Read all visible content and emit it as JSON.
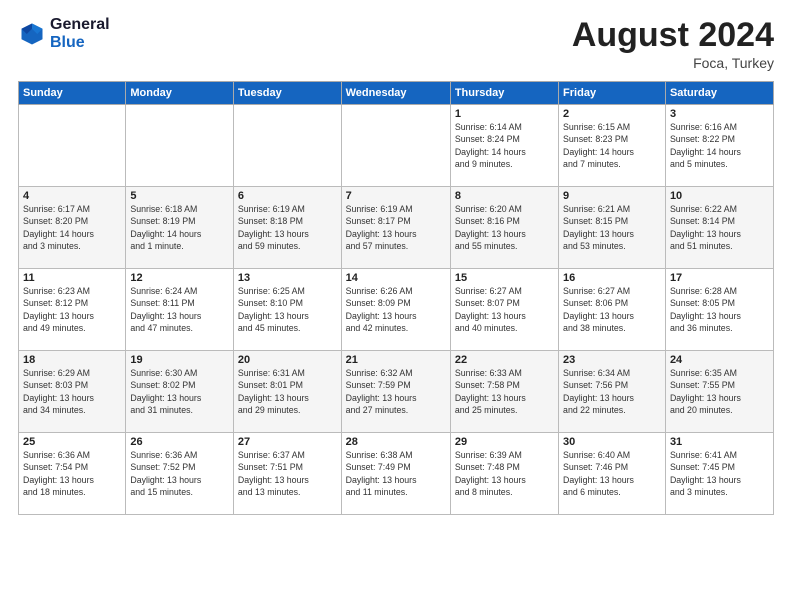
{
  "logo": {
    "line1": "General",
    "line2": "Blue"
  },
  "title": "August 2024",
  "location": "Foca, Turkey",
  "days_header": [
    "Sunday",
    "Monday",
    "Tuesday",
    "Wednesday",
    "Thursday",
    "Friday",
    "Saturday"
  ],
  "weeks": [
    [
      {
        "num": "",
        "info": ""
      },
      {
        "num": "",
        "info": ""
      },
      {
        "num": "",
        "info": ""
      },
      {
        "num": "",
        "info": ""
      },
      {
        "num": "1",
        "info": "Sunrise: 6:14 AM\nSunset: 8:24 PM\nDaylight: 14 hours\nand 9 minutes."
      },
      {
        "num": "2",
        "info": "Sunrise: 6:15 AM\nSunset: 8:23 PM\nDaylight: 14 hours\nand 7 minutes."
      },
      {
        "num": "3",
        "info": "Sunrise: 6:16 AM\nSunset: 8:22 PM\nDaylight: 14 hours\nand 5 minutes."
      }
    ],
    [
      {
        "num": "4",
        "info": "Sunrise: 6:17 AM\nSunset: 8:20 PM\nDaylight: 14 hours\nand 3 minutes."
      },
      {
        "num": "5",
        "info": "Sunrise: 6:18 AM\nSunset: 8:19 PM\nDaylight: 14 hours\nand 1 minute."
      },
      {
        "num": "6",
        "info": "Sunrise: 6:19 AM\nSunset: 8:18 PM\nDaylight: 13 hours\nand 59 minutes."
      },
      {
        "num": "7",
        "info": "Sunrise: 6:19 AM\nSunset: 8:17 PM\nDaylight: 13 hours\nand 57 minutes."
      },
      {
        "num": "8",
        "info": "Sunrise: 6:20 AM\nSunset: 8:16 PM\nDaylight: 13 hours\nand 55 minutes."
      },
      {
        "num": "9",
        "info": "Sunrise: 6:21 AM\nSunset: 8:15 PM\nDaylight: 13 hours\nand 53 minutes."
      },
      {
        "num": "10",
        "info": "Sunrise: 6:22 AM\nSunset: 8:14 PM\nDaylight: 13 hours\nand 51 minutes."
      }
    ],
    [
      {
        "num": "11",
        "info": "Sunrise: 6:23 AM\nSunset: 8:12 PM\nDaylight: 13 hours\nand 49 minutes."
      },
      {
        "num": "12",
        "info": "Sunrise: 6:24 AM\nSunset: 8:11 PM\nDaylight: 13 hours\nand 47 minutes."
      },
      {
        "num": "13",
        "info": "Sunrise: 6:25 AM\nSunset: 8:10 PM\nDaylight: 13 hours\nand 45 minutes."
      },
      {
        "num": "14",
        "info": "Sunrise: 6:26 AM\nSunset: 8:09 PM\nDaylight: 13 hours\nand 42 minutes."
      },
      {
        "num": "15",
        "info": "Sunrise: 6:27 AM\nSunset: 8:07 PM\nDaylight: 13 hours\nand 40 minutes."
      },
      {
        "num": "16",
        "info": "Sunrise: 6:27 AM\nSunset: 8:06 PM\nDaylight: 13 hours\nand 38 minutes."
      },
      {
        "num": "17",
        "info": "Sunrise: 6:28 AM\nSunset: 8:05 PM\nDaylight: 13 hours\nand 36 minutes."
      }
    ],
    [
      {
        "num": "18",
        "info": "Sunrise: 6:29 AM\nSunset: 8:03 PM\nDaylight: 13 hours\nand 34 minutes."
      },
      {
        "num": "19",
        "info": "Sunrise: 6:30 AM\nSunset: 8:02 PM\nDaylight: 13 hours\nand 31 minutes."
      },
      {
        "num": "20",
        "info": "Sunrise: 6:31 AM\nSunset: 8:01 PM\nDaylight: 13 hours\nand 29 minutes."
      },
      {
        "num": "21",
        "info": "Sunrise: 6:32 AM\nSunset: 7:59 PM\nDaylight: 13 hours\nand 27 minutes."
      },
      {
        "num": "22",
        "info": "Sunrise: 6:33 AM\nSunset: 7:58 PM\nDaylight: 13 hours\nand 25 minutes."
      },
      {
        "num": "23",
        "info": "Sunrise: 6:34 AM\nSunset: 7:56 PM\nDaylight: 13 hours\nand 22 minutes."
      },
      {
        "num": "24",
        "info": "Sunrise: 6:35 AM\nSunset: 7:55 PM\nDaylight: 13 hours\nand 20 minutes."
      }
    ],
    [
      {
        "num": "25",
        "info": "Sunrise: 6:36 AM\nSunset: 7:54 PM\nDaylight: 13 hours\nand 18 minutes."
      },
      {
        "num": "26",
        "info": "Sunrise: 6:36 AM\nSunset: 7:52 PM\nDaylight: 13 hours\nand 15 minutes."
      },
      {
        "num": "27",
        "info": "Sunrise: 6:37 AM\nSunset: 7:51 PM\nDaylight: 13 hours\nand 13 minutes."
      },
      {
        "num": "28",
        "info": "Sunrise: 6:38 AM\nSunset: 7:49 PM\nDaylight: 13 hours\nand 11 minutes."
      },
      {
        "num": "29",
        "info": "Sunrise: 6:39 AM\nSunset: 7:48 PM\nDaylight: 13 hours\nand 8 minutes."
      },
      {
        "num": "30",
        "info": "Sunrise: 6:40 AM\nSunset: 7:46 PM\nDaylight: 13 hours\nand 6 minutes."
      },
      {
        "num": "31",
        "info": "Sunrise: 6:41 AM\nSunset: 7:45 PM\nDaylight: 13 hours\nand 3 minutes."
      }
    ]
  ]
}
